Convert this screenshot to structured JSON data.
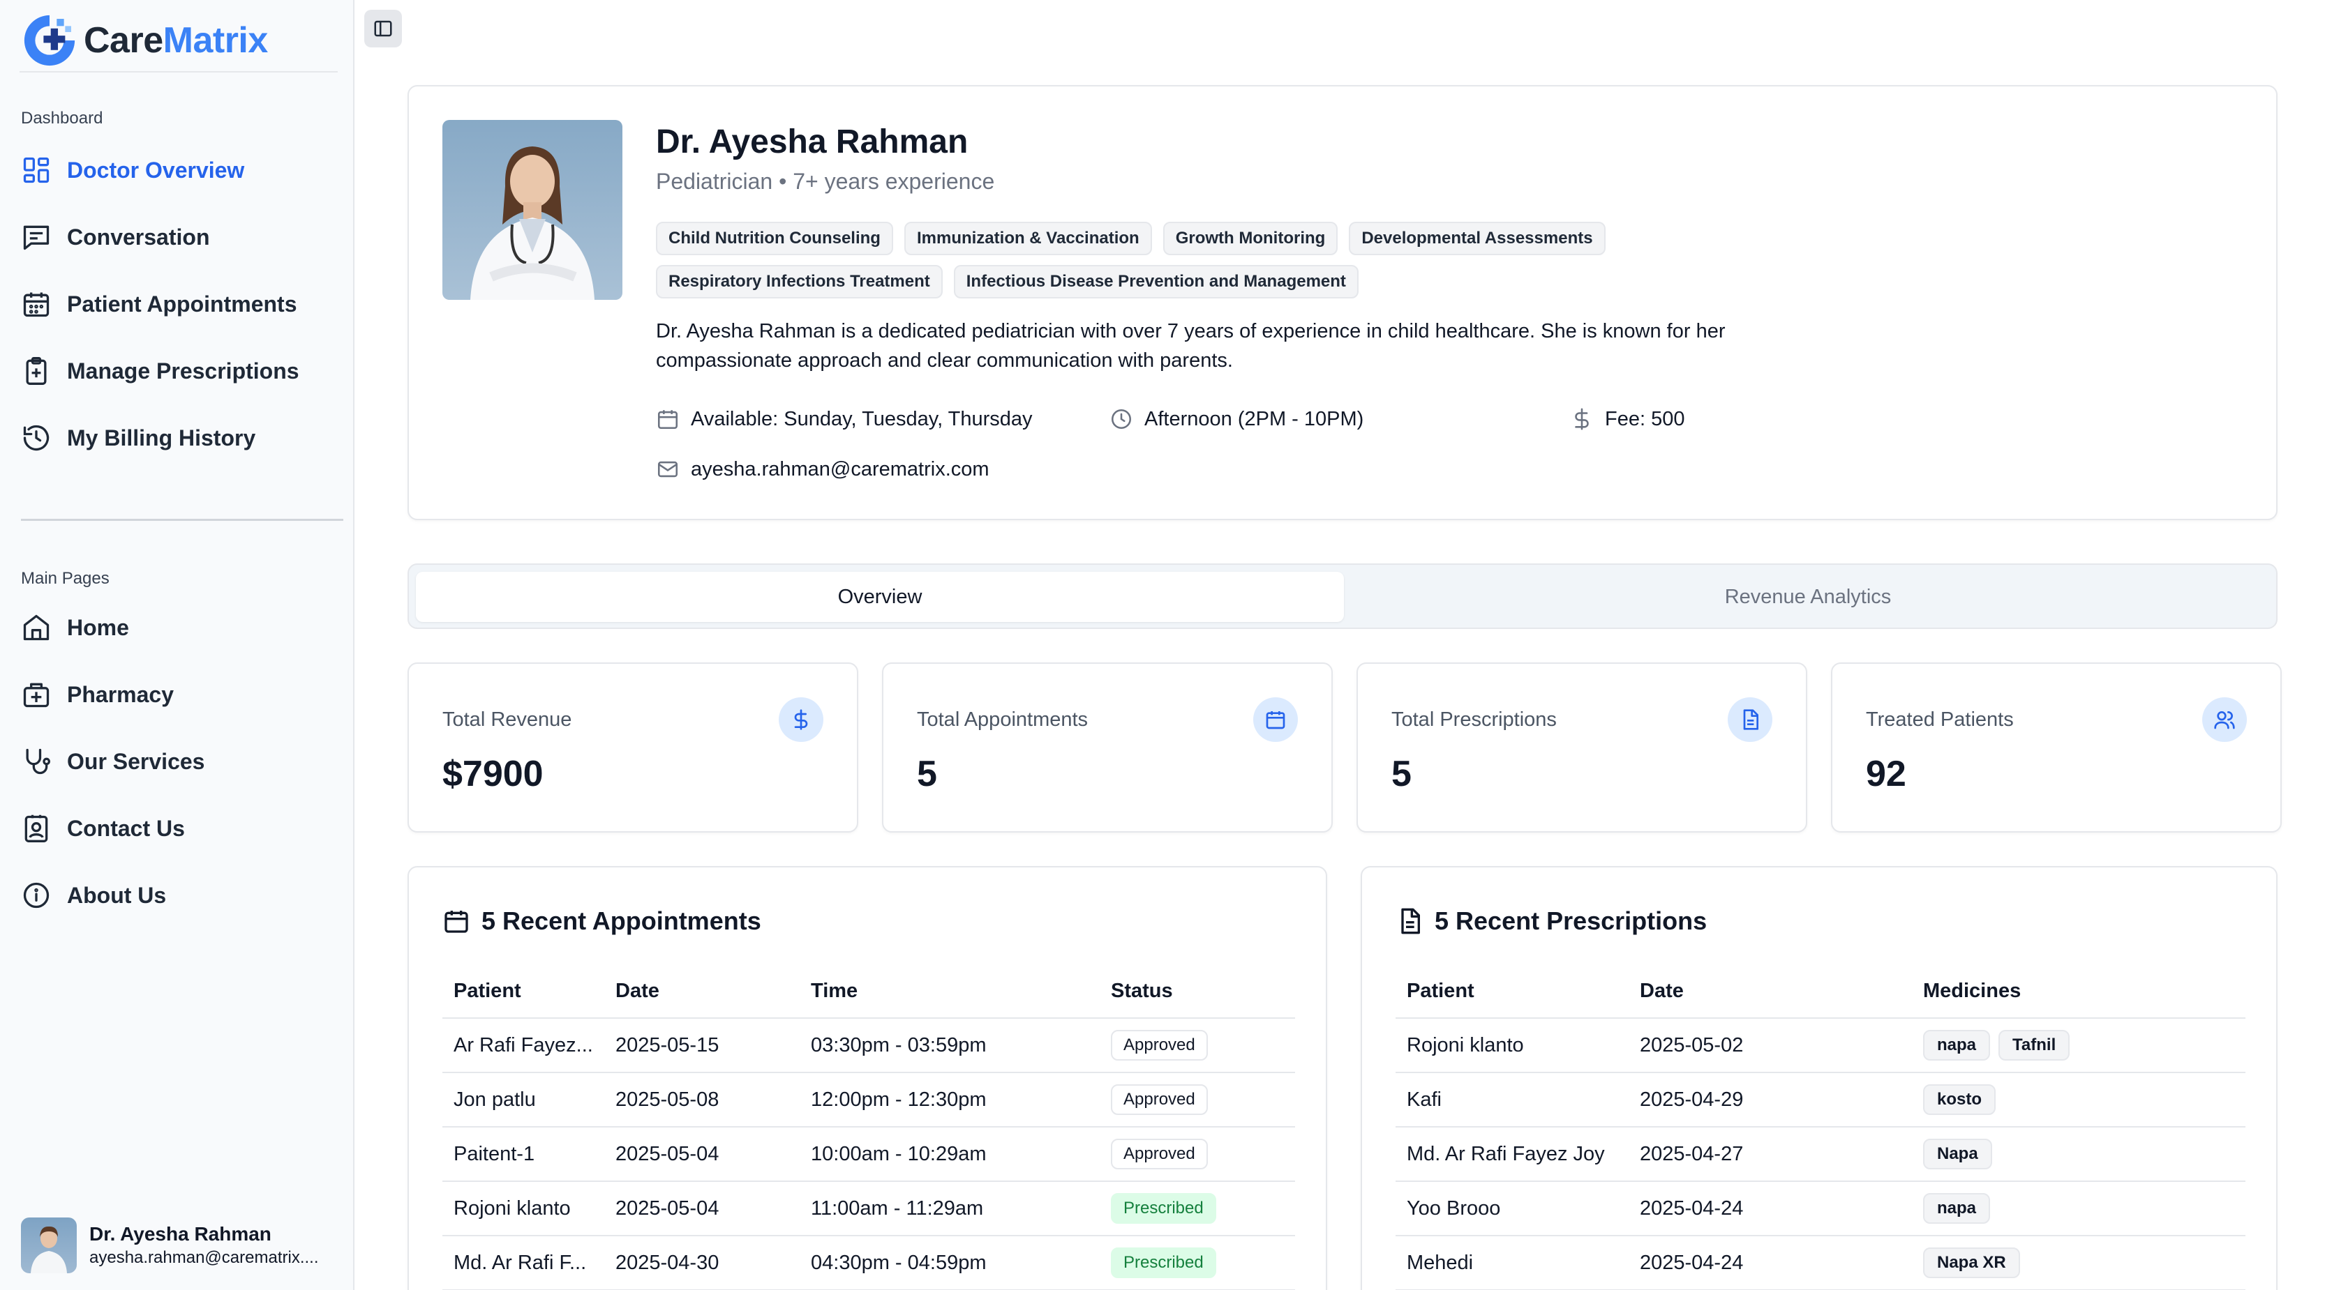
{
  "brand": {
    "name_part1": "Care",
    "name_part2": "Matrix",
    "accent": "#3b82f6"
  },
  "sidebar": {
    "dashboard_label": "Dashboard",
    "dashboard_items": [
      {
        "label": "Doctor Overview",
        "icon": "layout-grid-icon",
        "active": true
      },
      {
        "label": "Conversation",
        "icon": "message-square-icon"
      },
      {
        "label": "Patient Appointments",
        "icon": "calendar-icon"
      },
      {
        "label": "Manage Prescriptions",
        "icon": "clipboard-plus-icon"
      },
      {
        "label": "My Billing History",
        "icon": "history-icon"
      }
    ],
    "main_label": "Main Pages",
    "main_items": [
      {
        "label": "Home",
        "icon": "home-icon"
      },
      {
        "label": "Pharmacy",
        "icon": "pharmacy-icon"
      },
      {
        "label": "Our Services",
        "icon": "stethoscope-icon"
      },
      {
        "label": "Contact Us",
        "icon": "contact-icon"
      },
      {
        "label": "About Us",
        "icon": "info-icon"
      }
    ],
    "user": {
      "name": "Dr. Ayesha Rahman",
      "email": "ayesha.rahman@carematrix...."
    }
  },
  "profile": {
    "name": "Dr. Ayesha Rahman",
    "subtitle": "Pediatrician • 7+ years experience",
    "tags": [
      "Child Nutrition Counseling",
      "Immunization & Vaccination",
      "Growth Monitoring",
      "Developmental Assessments",
      "Respiratory Infections Treatment",
      "Infectious Disease Prevention and Management"
    ],
    "bio": "Dr. Ayesha Rahman is a dedicated pediatrician with over 7 years of experience in child healthcare. She is known for her compassionate approach and clear communication with parents.",
    "availability": "Available: Sunday, Tuesday, Thursday",
    "time": "Afternoon (2PM - 10PM)",
    "fee": "Fee: 500",
    "email": "ayesha.rahman@carematrix.com"
  },
  "tabs": {
    "overview": "Overview",
    "revenue": "Revenue Analytics"
  },
  "stats": [
    {
      "label": "Total Revenue",
      "value": "$7900",
      "icon": "dollar-icon"
    },
    {
      "label": "Total Appointments",
      "value": "5",
      "icon": "calendar-icon"
    },
    {
      "label": "Total Prescriptions",
      "value": "5",
      "icon": "file-text-icon"
    },
    {
      "label": "Treated Patients",
      "value": "92",
      "icon": "users-icon"
    }
  ],
  "appointments": {
    "title": "5 Recent Appointments",
    "headers": [
      "Patient",
      "Date",
      "Time",
      "Status"
    ],
    "rows": [
      {
        "patient": "Ar Rafi Fayez...",
        "date": "2025-05-15",
        "time": "03:30pm - 03:59pm",
        "status": "Approved"
      },
      {
        "patient": "Jon patlu",
        "date": "2025-05-08",
        "time": "12:00pm - 12:30pm",
        "status": "Approved"
      },
      {
        "patient": "Paitent-1",
        "date": "2025-05-04",
        "time": "10:00am - 10:29am",
        "status": "Approved"
      },
      {
        "patient": "Rojoni klanto",
        "date": "2025-05-04",
        "time": "11:00am - 11:29am",
        "status": "Prescribed"
      },
      {
        "patient": "Md. Ar Rafi F...",
        "date": "2025-04-30",
        "time": "04:30pm - 04:59pm",
        "status": "Prescribed"
      }
    ]
  },
  "prescriptions": {
    "title": "5 Recent Prescriptions",
    "headers": [
      "Patient",
      "Date",
      "Medicines"
    ],
    "rows": [
      {
        "patient": "Rojoni klanto",
        "date": "2025-05-02",
        "medicines": [
          "napa",
          "Tafnil"
        ]
      },
      {
        "patient": "Kafi",
        "date": "2025-04-29",
        "medicines": [
          "kosto"
        ]
      },
      {
        "patient": "Md. Ar Rafi Fayez Joy",
        "date": "2025-04-27",
        "medicines": [
          "Napa"
        ]
      },
      {
        "patient": "Yoo Brooo",
        "date": "2025-04-24",
        "medicines": [
          "napa"
        ]
      },
      {
        "patient": "Mehedi",
        "date": "2025-04-24",
        "medicines": [
          "Napa XR"
        ]
      }
    ]
  }
}
